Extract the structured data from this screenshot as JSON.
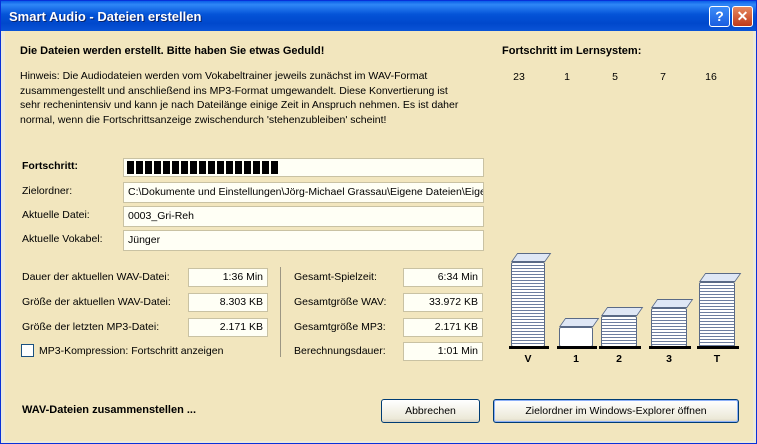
{
  "window": {
    "title": "Smart Audio - Dateien erstellen",
    "help_label": "?",
    "close_label": "✕"
  },
  "header": {
    "heading": "Die Dateien werden erstellt. Bitte haben Sie etwas Geduld!",
    "hint_lines": [
      "Hinweis: Die Audiodateien werden vom Vokabeltrainer jeweils zunächst im WAV-Format",
      "zusammengestellt und anschließend ins MP3-Format umgewandelt. Diese Konvertierung ist",
      "sehr rechenintensiv und kann je nach Dateilänge einige Zeit in Anspruch nehmen. Es ist daher",
      "normal, wenn die Fortschrittsanzeige zwischendurch 'stehenzubleiben' scheint!"
    ]
  },
  "learning_system": {
    "title": "Fortschritt im Lernsystem:",
    "counts": [
      "23",
      "1",
      "5",
      "7",
      "16"
    ],
    "box_labels": [
      "V",
      "1",
      "2",
      "3",
      "T"
    ]
  },
  "progress": {
    "label": "Fortschritt:",
    "fraction": 0.44
  },
  "fields": {
    "target_folder_label": "Zielordner:",
    "target_folder_value": "C:\\Dokumente und Einstellungen\\Jörg-Michael Grassau\\Eigene Dateien\\Eigene",
    "current_file_label": "Aktuelle Datei:",
    "current_file_value": "0003_Gri-Reh",
    "current_vocab_label": "Aktuelle Vokabel:",
    "current_vocab_value": "Jünger"
  },
  "stats_left": [
    {
      "label": "Dauer der aktuellen WAV-Datei:",
      "value": "1:36 Min"
    },
    {
      "label": "Größe der aktuellen WAV-Datei:",
      "value": "8.303 KB"
    },
    {
      "label": "Größe der letzten MP3-Datei:",
      "value": "2.171 KB"
    }
  ],
  "stats_right": [
    {
      "label": "Gesamt-Spielzeit:",
      "value": "6:34 Min"
    },
    {
      "label": "Gesamtgröße WAV:",
      "value": "33.972 KB"
    },
    {
      "label": "Gesamtgröße MP3:",
      "value": "2.171 KB"
    },
    {
      "label": "Berechnungsdauer:",
      "value": "1:01 Min"
    }
  ],
  "mp3_checkbox": {
    "label": "MP3-Kompression: Fortschritt anzeigen",
    "checked": false
  },
  "status_text": "WAV-Dateien zusammenstellen ...",
  "buttons": {
    "cancel": "Abbrechen",
    "open_folder": "Zielordner im Windows-Explorer öffnen"
  },
  "colors": {
    "title_bar": "#0453d7",
    "client_bg": "#f2e6be",
    "field_bg": "#fffff5"
  }
}
